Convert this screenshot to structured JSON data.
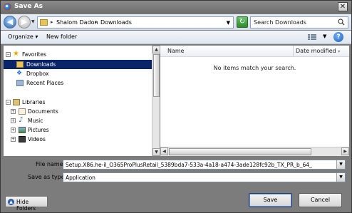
{
  "window": {
    "title": "Save As"
  },
  "address": {
    "crumbs": [
      "Shalom Dadon",
      "Downloads"
    ],
    "search_placeholder": "Search Downloads"
  },
  "toolbar": {
    "organize": "Organize",
    "new_folder": "New folder"
  },
  "nav": {
    "favorites_label": "Favorites",
    "favorites": [
      {
        "label": "Downloads",
        "selected": true
      },
      {
        "label": "Dropbox",
        "selected": false
      },
      {
        "label": "Recent Places",
        "selected": false
      }
    ],
    "libraries_label": "Libraries",
    "libraries": [
      {
        "label": "Documents"
      },
      {
        "label": "Music"
      },
      {
        "label": "Pictures"
      },
      {
        "label": "Videos"
      }
    ]
  },
  "list": {
    "col_name": "Name",
    "col_date": "Date modified",
    "empty_text": "No items match your search."
  },
  "form": {
    "file_name_label": "File name:",
    "file_name_value": "Setup.X86.he-il_O365ProPlusRetail_5389bda7-533a-4a18-a474-3ade128fc92b_TX_PR_b_64_",
    "save_type_label": "Save as type:",
    "save_type_value": "Application"
  },
  "buttons": {
    "hide_folders": "Hide Folders",
    "save": "Save",
    "cancel": "Cancel"
  },
  "icons": {
    "app": "browser-icon",
    "back": "back-arrow-icon",
    "forward": "forward-arrow-icon",
    "refresh": "refresh-icon",
    "search": "search-icon",
    "help": "help-icon",
    "views": "views-icon"
  }
}
